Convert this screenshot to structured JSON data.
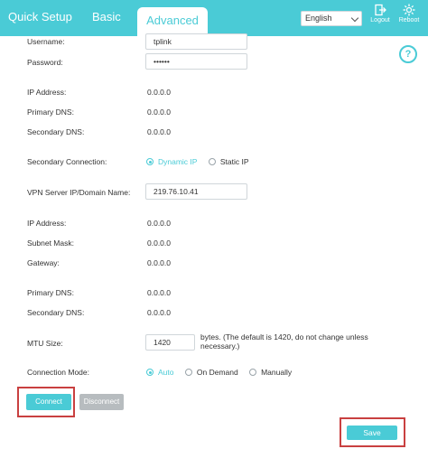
{
  "nav": {
    "quick_setup": "Quick Setup",
    "basic": "Basic",
    "advanced": "Advanced",
    "language": "English",
    "logout": "Logout",
    "reboot": "Reboot"
  },
  "form": {
    "username_label": "Username:",
    "username_value": "tplink",
    "password_label": "Password:",
    "password_value": "••••••",
    "ip_address_label": "IP Address:",
    "ip_address_value": "0.0.0.0",
    "primary_dns_label": "Primary DNS:",
    "primary_dns_value": "0.0.0.0",
    "secondary_dns_label": "Secondary DNS:",
    "secondary_dns_value": "0.0.0.0",
    "secondary_connection_label": "Secondary Connection:",
    "secondary_connection_options": [
      "Dynamic IP",
      "Static IP"
    ],
    "vpn_server_label": "VPN Server IP/Domain Name:",
    "vpn_server_value": "219.76.10.41",
    "ip_address2_label": "IP Address:",
    "ip_address2_value": "0.0.0.0",
    "subnet_mask_label": "Subnet Mask:",
    "subnet_mask_value": "0.0.0.0",
    "gateway_label": "Gateway:",
    "gateway_value": "0.0.0.0",
    "primary_dns2_label": "Primary DNS:",
    "primary_dns2_value": "0.0.0.0",
    "secondary_dns2_label": "Secondary DNS:",
    "secondary_dns2_value": "0.0.0.0",
    "mtu_label": "MTU Size:",
    "mtu_value": "1420",
    "mtu_note": "bytes. (The default is 1420, do not change unless necessary.)",
    "connection_mode_label": "Connection Mode:",
    "connection_mode_options": [
      "Auto",
      "On Demand",
      "Manually"
    ]
  },
  "buttons": {
    "connect": "Connect",
    "disconnect": "Disconnect",
    "save": "Save"
  },
  "colors": {
    "accent": "#4acbd6",
    "highlight": "#c94040",
    "disabled": "#b7bcbf"
  },
  "icons": {
    "logout": "logout-icon",
    "reboot": "reboot-icon",
    "help": "help-icon"
  }
}
